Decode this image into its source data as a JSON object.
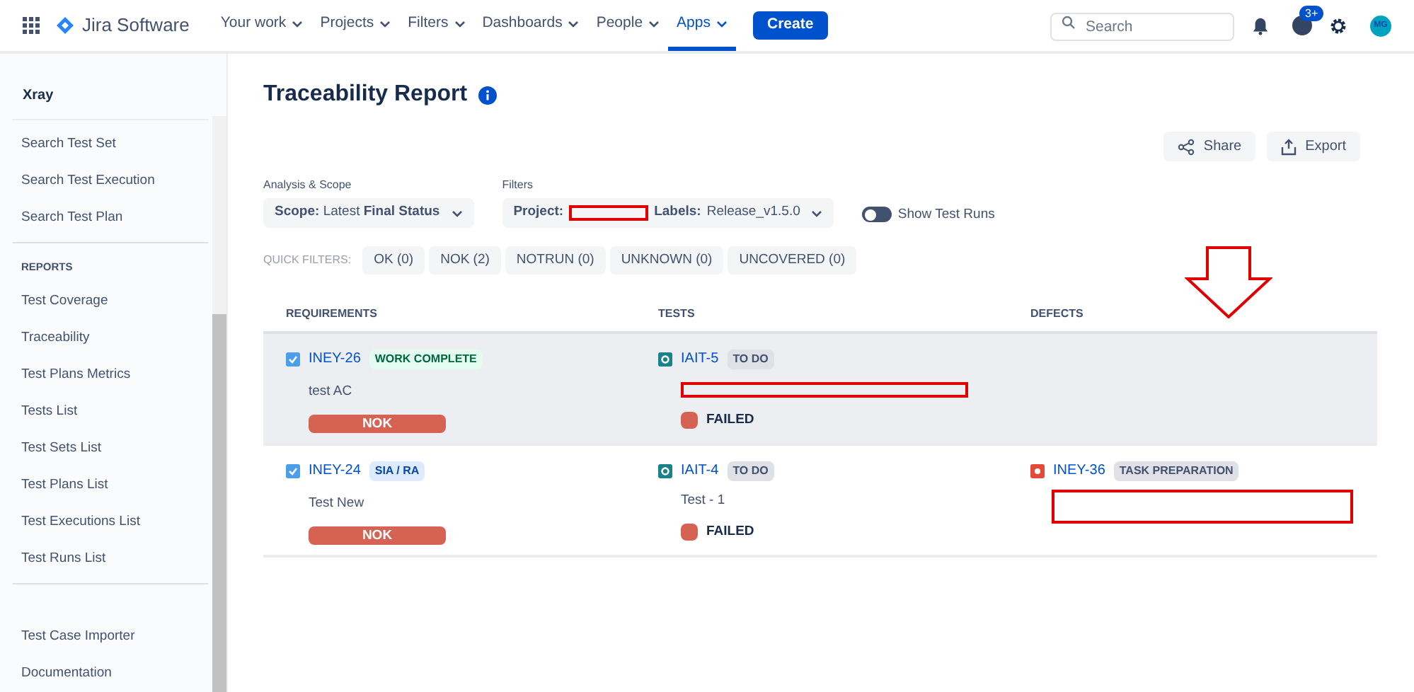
{
  "nav": {
    "product": "Jira Software",
    "menus": [
      {
        "label": "Your work",
        "selected": false
      },
      {
        "label": "Projects",
        "selected": false
      },
      {
        "label": "Filters",
        "selected": false
      },
      {
        "label": "Dashboards",
        "selected": false
      },
      {
        "label": "People",
        "selected": false
      },
      {
        "label": "Apps",
        "selected": true
      }
    ],
    "create": "Create",
    "search": {
      "placeholder": "Search"
    },
    "notification_badge": "3+",
    "avatar": "MG"
  },
  "sidebar": {
    "title": "Xray",
    "sections": [
      {
        "items": [
          "Search Test Set",
          "Search Test Execution",
          "Search Test Plan"
        ]
      },
      {
        "heading": "REPORTS",
        "items": [
          "Test Coverage",
          "Traceability",
          "Test Plans Metrics",
          "Tests List",
          "Test Sets List",
          "Test Plans List",
          "Test Executions List",
          "Test Runs List"
        ]
      },
      {
        "items": [
          "Test Case Importer",
          "Documentation"
        ]
      }
    ]
  },
  "report": {
    "title": "Traceability Report",
    "actions": [
      "Share",
      "Export"
    ],
    "scope": {
      "label": "Analysis & Scope",
      "value": "**Scope:** Latest **Final Status**"
    },
    "filters": {
      "label": "Filters",
      "project_label": "Project:",
      "labels_label": "Labels:",
      "labels_value": "Release_v1.5.0"
    },
    "toggle": {
      "label": "Show Test Runs",
      "on": false
    },
    "quick_filters": {
      "label": "QUICK FILTERS:",
      "items": [
        "OK (0)",
        "NOK (2)",
        "NOTRUN (0)",
        "UNKNOWN (0)",
        "UNCOVERED (0)"
      ]
    },
    "table": {
      "columns": [
        "REQUIREMENTS",
        "TESTS",
        "DEFECTS"
      ],
      "rows": [
        {
          "selected": true,
          "requirement": {
            "key": "INEY-26",
            "status": {
              "label": "WORK COMPLETE",
              "color": "#006644"
            },
            "summary": "test AC",
            "result": "NOK"
          },
          "test": {
            "key": "IAIT-5",
            "status": "TO DO",
            "result": "FAILED"
          }
        },
        {
          "selected": false,
          "requirement": {
            "key": "INEY-24",
            "status": {
              "label": "SIA / RA",
              "color": "#0747a6"
            },
            "summary": "Test New",
            "result": "NOK"
          },
          "test": {
            "key": "IAIT-4",
            "status": "TO DO",
            "summary": "Test - 1",
            "result": "FAILED"
          },
          "defect": {
            "key": "INEY-36",
            "status": "TASK PREPARATION"
          }
        }
      ]
    }
  }
}
